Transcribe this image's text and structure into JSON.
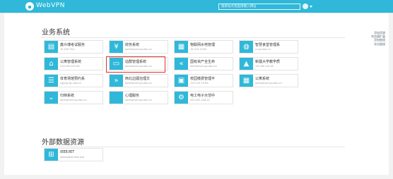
{
  "header": {
    "brand": "WebVPN",
    "search_placeholder": "搜索站点或直接输入网址"
  },
  "sections": {
    "business": "业务系统",
    "external": "外部数据资源"
  },
  "tiles": [
    {
      "name": "鑫众博考试服务",
      "host": "10.100.76.1",
      "icon": "book-icon",
      "glyph": "▤"
    },
    {
      "name": "财务系统",
      "host": "authserver.sju.edu.cn",
      "icon": "yen-icon",
      "glyph": "¥"
    },
    {
      "name": "物联网水电管理",
      "host": "10.115.10.62",
      "icon": "ticket-icon",
      "glyph": "▦"
    },
    {
      "name": "智慧食堂管理系",
      "host": "cl.sju.edu.cn",
      "icon": "meal-icon",
      "glyph": "◍"
    },
    {
      "name": "公寓管理系统",
      "host": "210.159.237.62",
      "icon": "home-icon",
      "glyph": "⌂"
    },
    {
      "name": "站群管理系统",
      "host": "authserver.sju.edu.cn",
      "icon": "monitor-icon",
      "glyph": "▭"
    },
    {
      "name": "国有资产全生命",
      "host": "authserver.sju.edu.cn",
      "icon": "double-left-icon",
      "glyph": "«"
    },
    {
      "name": "新疆大学教学质",
      "host": "120.36.244.16",
      "icon": "graduation-icon",
      "glyph": "▲"
    },
    {
      "name": "体育场馆预约系",
      "host": "cgyyyj.sju.edu.cn",
      "icon": "list-icon",
      "glyph": "☰"
    },
    {
      "name": "西北边疆治理文",
      "host": "authserver.sju.edu.cn",
      "icon": "double-right-icon",
      "glyph": "»"
    },
    {
      "name": "校园缴费管理平",
      "host": "110.115.15.85",
      "icon": "payment-icon",
      "glyph": "▣"
    },
    {
      "name": "公寓系统",
      "host": "authserver.sju.edu.cn",
      "icon": "calendar-icon",
      "glyph": "▦"
    },
    {
      "name": "归档系统",
      "host": "authserver.sju.edu.cn",
      "icon": "chevron-down-icon",
      "glyph": "⌄"
    },
    {
      "name": "心理服务",
      "host": "authserver.sju.edu.cn",
      "icon": "apple-icon",
      "glyph": ""
    },
    {
      "name": "电工电子示范中",
      "host": "202.201.244.22",
      "icon": "gears-icon",
      "glyph": "⚙"
    }
  ],
  "external_tiles": [
    {
      "name": "IEEE/IET",
      "host": "ieeexplore.ieee.org",
      "icon": "ieee-icon",
      "glyph": "⊞"
    }
  ],
  "right_links": [
    "添加资源",
    "浏览器扩展",
    "添加链接",
    "导出链接"
  ],
  "colors": {
    "accent": "#2fb8d9",
    "highlight": "#e0312f"
  }
}
